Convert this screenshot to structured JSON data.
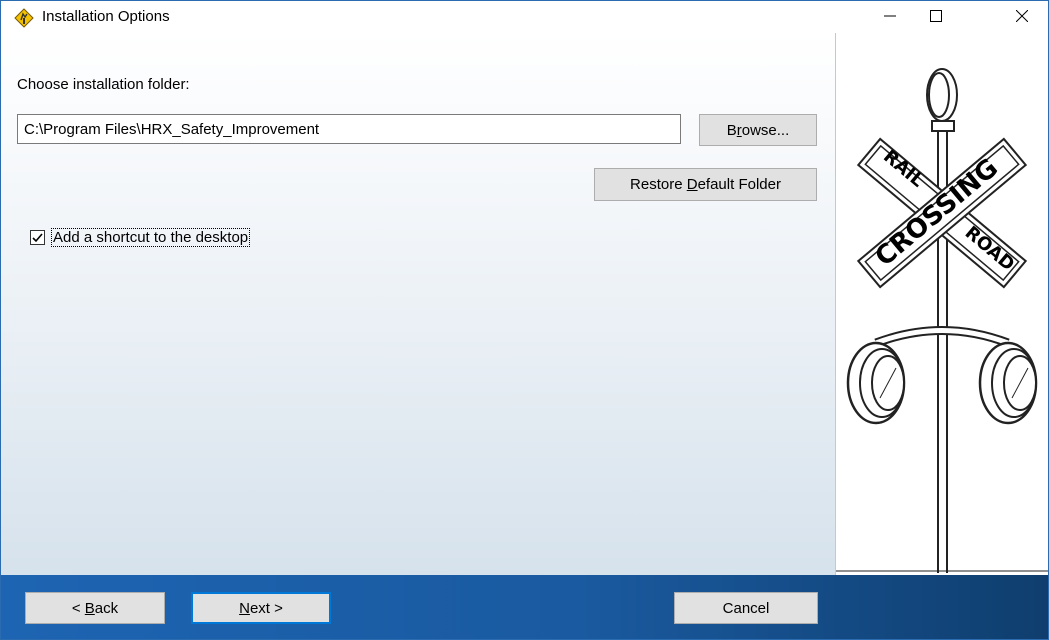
{
  "window": {
    "title": "Installation Options",
    "controls": {
      "minimize_icon": "minimize-icon",
      "maximize_icon": "maximize-icon",
      "close_icon": "close-icon"
    }
  },
  "main": {
    "folder_label": "Choose installation folder:",
    "folder_path": "C:\\Program Files\\HRX_Safety_Improvement",
    "browse_button": {
      "pre": "B",
      "accel": "r",
      "post": "owse..."
    },
    "restore_button": {
      "pre": "Restore ",
      "accel": "D",
      "post": "efault Folder"
    },
    "shortcut_checkbox": {
      "label": "Add a shortcut to the desktop",
      "checked": true
    }
  },
  "side_image": {
    "description_icon": "railroad-crossing-sign",
    "sign_words": [
      "RAIL",
      "ROAD",
      "CROSSING"
    ]
  },
  "footer": {
    "back_button": {
      "pre": "< ",
      "accel": "B",
      "post": "ack"
    },
    "next_button": {
      "pre": "",
      "accel": "N",
      "post": "ext >"
    },
    "cancel_button": "Cancel"
  },
  "colors": {
    "footer_start": "#1d64b2",
    "footer_end": "#0f3e6e",
    "button_face": "#e1e1e1",
    "default_button_border": "#0078d7"
  }
}
